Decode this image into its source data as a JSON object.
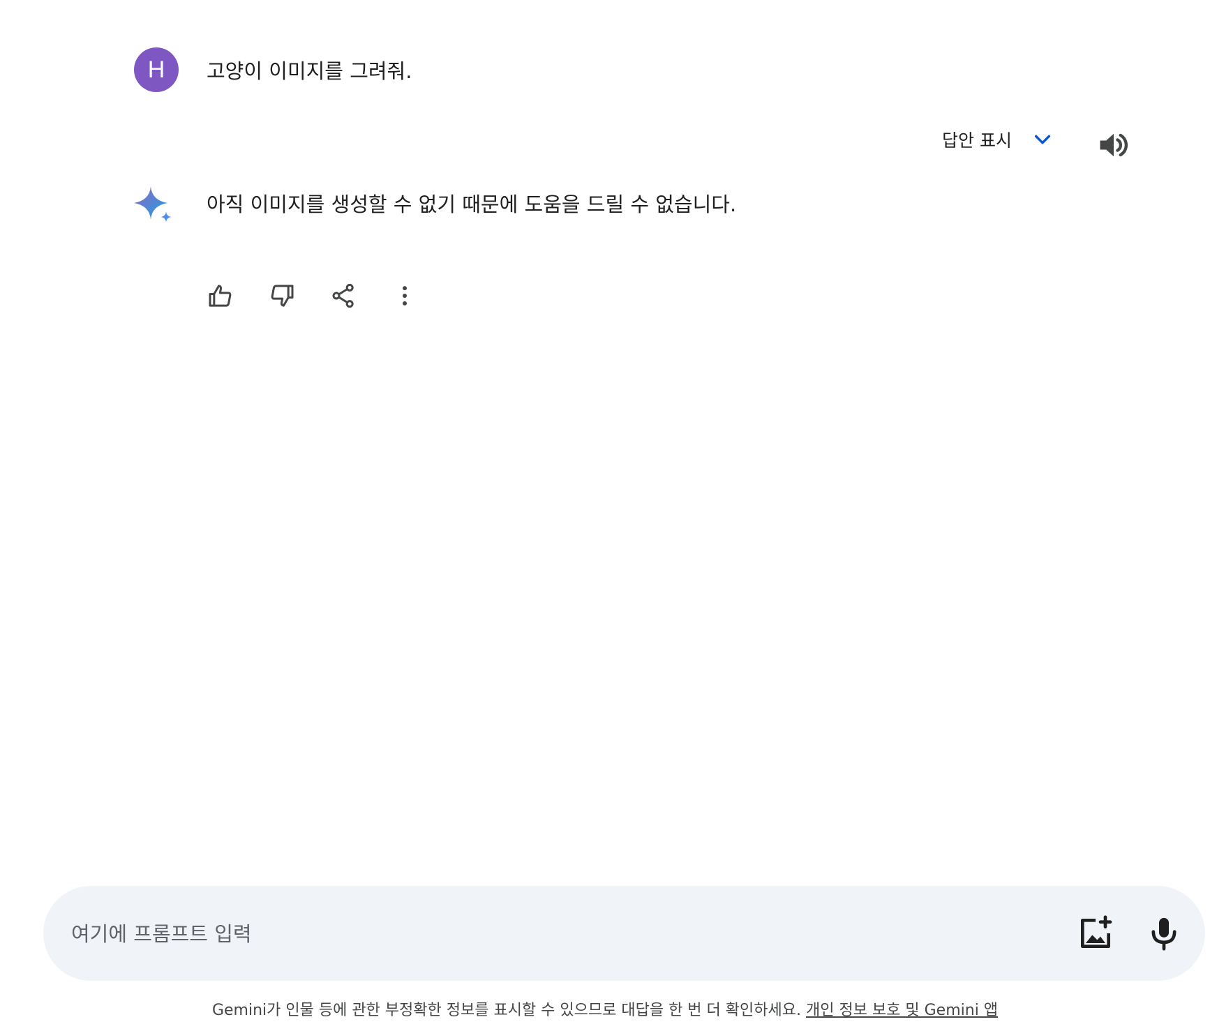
{
  "user_message": {
    "avatar_letter": "H",
    "text": "고양이 이미지를 그려줘."
  },
  "response_controls": {
    "drafts_label": "답안 표시",
    "drafts_icon": "chevron-down-icon",
    "tts_icon": "speaker-icon"
  },
  "model_response": {
    "icon": "gemini-sparkle-icon",
    "text": "아직 이미지를 생성할 수 없기 때문에 도움을 드릴 수 없습니다."
  },
  "response_actions": [
    "thumb-up-icon",
    "thumb-down-icon",
    "share-icon",
    "more-vert-icon"
  ],
  "input": {
    "placeholder": "여기에 프롬프트 입력",
    "value": "",
    "image_button_icon": "add-image-icon",
    "mic_button_icon": "mic-icon"
  },
  "footer": {
    "disclaimer": "Gemini가 인물 등에 관한 부정확한 정보를 표시할 수 있으므로 대답을 한 번 더 확인하세요. ",
    "link": "개인 정보 보호 및 Gemini 앱"
  },
  "colors": {
    "avatar": "#7e57c2",
    "accent_blue": "#0b57d0",
    "input_bg": "#f0f4f9",
    "icon": "#444746"
  }
}
